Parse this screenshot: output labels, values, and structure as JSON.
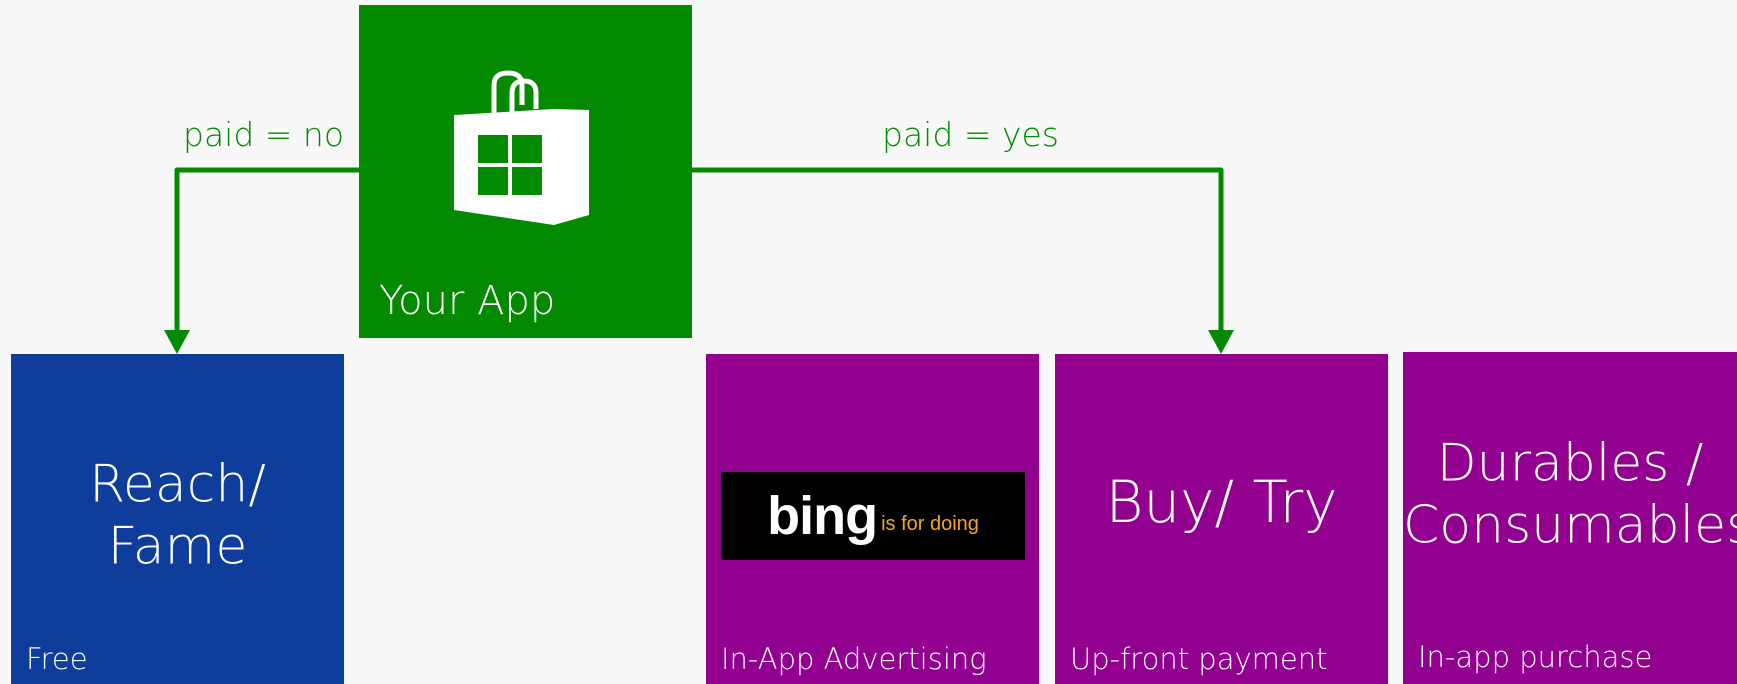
{
  "colors": {
    "background": "#f8f8f8",
    "app_green": "#038a00",
    "free_blue": "#0f3d9c",
    "paid_purple": "#92008f",
    "connector": "#038a00",
    "bing_tagline": "#f5a623"
  },
  "app_tile": {
    "icon": "store-bag-icon",
    "label": "Your App"
  },
  "branches": {
    "left_label": "paid = no",
    "right_label": "paid = yes"
  },
  "tiles": {
    "free": {
      "line1": "Reach/",
      "line2": "Fame",
      "footer": "Free"
    },
    "advertising": {
      "logo_text": "bing",
      "logo_tagline": "is for doing",
      "footer": "In-App Advertising"
    },
    "buy_try": {
      "line1": "Buy/ Try",
      "footer": "Up-front payment"
    },
    "durables": {
      "line1": "Durables /",
      "line2": "Consumables",
      "footer": "In-app purchase"
    }
  }
}
